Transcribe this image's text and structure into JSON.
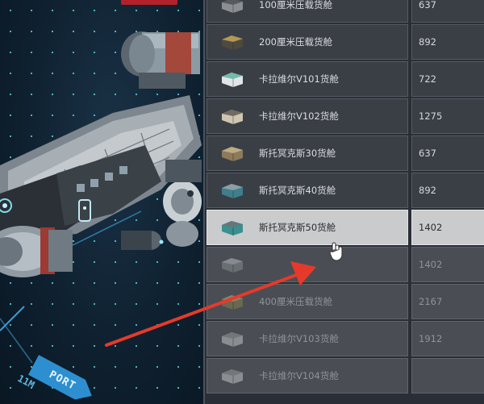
{
  "hud": {
    "port_label": "PORT",
    "distance_label": "11M"
  },
  "cargo_list": {
    "items": [
      {
        "name": "100厘米压载货舱",
        "value": "637",
        "icon": "cargo-crate-small-icon"
      },
      {
        "name": "200厘米压载货舱",
        "value": "892",
        "icon": "cargo-crate-gold-icon"
      },
      {
        "name": "卡拉维尔V101货舱",
        "value": "722",
        "icon": "cargo-pod-white-icon"
      },
      {
        "name": "卡拉维尔V102货舱",
        "value": "1275",
        "icon": "cargo-pod-tan-icon"
      },
      {
        "name": "斯托冥克斯30货舱",
        "value": "637",
        "icon": "cargo-crate-brown-icon"
      },
      {
        "name": "斯托冥克斯40货舱",
        "value": "892",
        "icon": "cargo-crate-teal-icon"
      },
      {
        "name": "斯托冥克斯50货舱",
        "value": "1402",
        "icon": "cargo-crate-teal-large-icon",
        "selected": true
      },
      {
        "name": "",
        "value": "1402",
        "icon": "cargo-crate-gray-icon",
        "dim": true
      },
      {
        "name": "400厘米压载货舱",
        "value": "2167",
        "icon": "cargo-crate-olive-icon",
        "dim": true
      },
      {
        "name": "卡拉维尔V103货舱",
        "value": "1912",
        "icon": "cargo-pod-gray-icon",
        "dim": true
      },
      {
        "name": "卡拉维尔V104货舱",
        "value": "",
        "icon": "cargo-pod-gray-icon",
        "dim": true
      }
    ]
  },
  "colors": {
    "selected_bg": "#c9cbcd",
    "annotation_arrow": "#e53a2b",
    "port_tag": "#2d8fd0"
  }
}
